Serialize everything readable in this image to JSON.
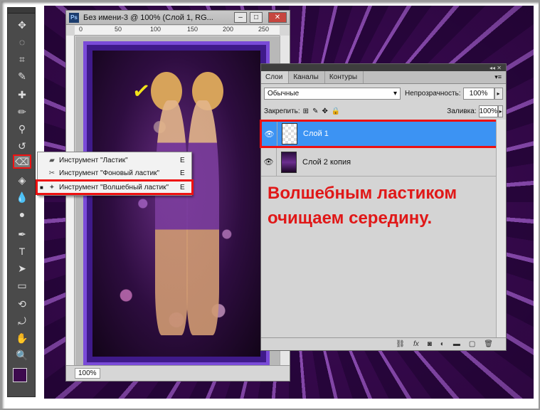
{
  "document": {
    "title": "Без имени-3 @ 100% (Слой 1, RG...",
    "app_badge": "Ps",
    "ruler_marks": [
      "0",
      "50",
      "100",
      "150",
      "200",
      "250"
    ],
    "zoom": "100%",
    "annotation_mark": "✓"
  },
  "tool_flyout": {
    "items": [
      {
        "label": "Инструмент \"Ластик\"",
        "shortcut": "E"
      },
      {
        "label": "Инструмент \"Фоновый ластик\"",
        "shortcut": "E"
      },
      {
        "label": "Инструмент \"Волшебный ластик\"",
        "shortcut": "E",
        "current_marker": "■"
      }
    ]
  },
  "layers_panel": {
    "tabs": [
      "Слои",
      "Каналы",
      "Контуры"
    ],
    "blend_mode": "Обычные",
    "opacity_label": "Непрозрачность:",
    "opacity_value": "100%",
    "lock_label": "Закрепить:",
    "fill_label": "Заливка:",
    "fill_value": "100%",
    "layers": [
      {
        "name": "Слой 1",
        "selected": true
      },
      {
        "name": "Слой 2 копия",
        "selected": false
      }
    ],
    "bottom_icons": [
      "link-icon",
      "fx-icon",
      "mask-icon",
      "adjustment-icon",
      "group-icon",
      "new-layer-icon",
      "trash-icon"
    ]
  },
  "instruction_text": "Волшебным ластиком очищаем середину.",
  "colors": {
    "accent_red": "#e11111",
    "selected_layer": "#3c93f3",
    "foreground_color": "#3d0a4e",
    "background_color": "#ffffff"
  }
}
